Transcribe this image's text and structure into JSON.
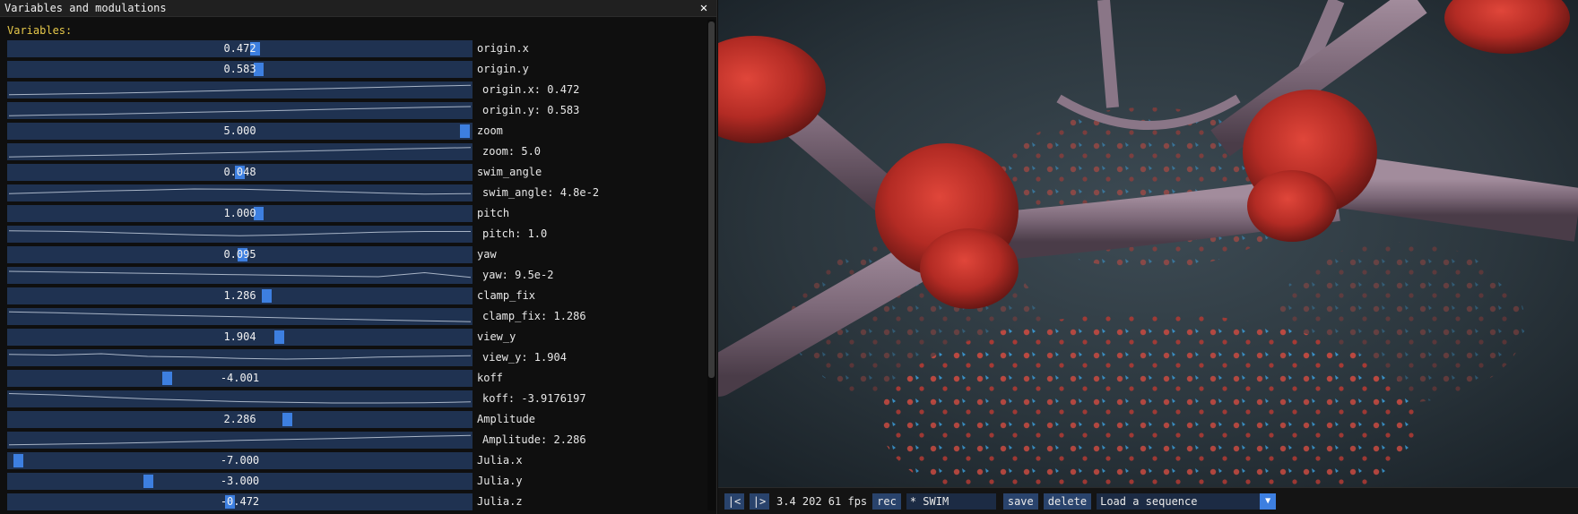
{
  "window": {
    "title": "Variables and modulations",
    "close_icon": "close-icon"
  },
  "variables_heading": "Variables:",
  "rows": [
    {
      "kind": "slider",
      "value": "0.472",
      "label": "origin.x",
      "grab_pct": 0.534
    },
    {
      "kind": "slider",
      "value": "0.583",
      "label": "origin.y",
      "grab_pct": 0.541
    },
    {
      "kind": "plot",
      "label": "origin.x: 0.472",
      "trace": [
        0.85,
        0.8,
        0.75,
        0.68,
        0.6,
        0.52,
        0.45,
        0.38,
        0.3,
        0.22,
        0.15
      ]
    },
    {
      "kind": "plot",
      "label": "origin.y: 0.583",
      "trace": [
        0.88,
        0.82,
        0.77,
        0.7,
        0.63,
        0.56,
        0.48,
        0.4,
        0.33,
        0.26,
        0.2
      ]
    },
    {
      "kind": "slider",
      "value": "5.000",
      "label": "zoom",
      "grab_pct": 0.995
    },
    {
      "kind": "plot",
      "label": "zoom: 5.0",
      "trace": [
        0.88,
        0.82,
        0.76,
        0.7,
        0.62,
        0.55,
        0.47,
        0.4,
        0.32,
        0.25,
        0.18
      ]
    },
    {
      "kind": "slider",
      "value": "0.048",
      "label": "swim_angle",
      "grab_pct": 0.5
    },
    {
      "kind": "plot",
      "label": "swim_angle: 4.8e-2",
      "trace": [
        0.55,
        0.45,
        0.35,
        0.28,
        0.2,
        0.22,
        0.3,
        0.4,
        0.5,
        0.58,
        0.55
      ]
    },
    {
      "kind": "slider",
      "value": "1.000",
      "label": "pitch",
      "grab_pct": 0.541
    },
    {
      "kind": "plot",
      "label": "pitch: 1.0",
      "trace": [
        0.25,
        0.28,
        0.35,
        0.45,
        0.55,
        0.62,
        0.55,
        0.45,
        0.35,
        0.3,
        0.3
      ]
    },
    {
      "kind": "slider",
      "value": "0.095",
      "label": "yaw",
      "grab_pct": 0.505
    },
    {
      "kind": "plot",
      "label": "yaw: 9.5e-2",
      "trace": [
        0.2,
        0.25,
        0.3,
        0.35,
        0.4,
        0.45,
        0.5,
        0.55,
        0.6,
        0.3,
        0.65
      ]
    },
    {
      "kind": "slider",
      "value": "1.286",
      "label": "clamp_fix",
      "grab_pct": 0.56
    },
    {
      "kind": "plot",
      "label": "clamp_fix: 1.286",
      "trace": [
        0.15,
        0.22,
        0.3,
        0.38,
        0.45,
        0.52,
        0.6,
        0.68,
        0.75,
        0.82,
        0.88
      ]
    },
    {
      "kind": "slider",
      "value": "1.904",
      "label": "view_y",
      "grab_pct": 0.587
    },
    {
      "kind": "plot",
      "label": "view_y: 1.904",
      "trace": [
        0.25,
        0.3,
        0.2,
        0.4,
        0.45,
        0.55,
        0.6,
        0.55,
        0.45,
        0.4,
        0.35
      ]
    },
    {
      "kind": "slider",
      "value": "-4.001",
      "label": "koff",
      "grab_pct": 0.34
    },
    {
      "kind": "plot",
      "label": "koff: -3.9176197",
      "trace": [
        0.1,
        0.2,
        0.35,
        0.5,
        0.6,
        0.7,
        0.75,
        0.8,
        0.8,
        0.78,
        0.72
      ]
    },
    {
      "kind": "slider",
      "value": "2.286",
      "label": "Amplitude",
      "grab_pct": 0.605
    },
    {
      "kind": "plot",
      "label": "Amplitude: 2.286",
      "trace": [
        0.85,
        0.8,
        0.75,
        0.68,
        0.6,
        0.52,
        0.45,
        0.38,
        0.3,
        0.22,
        0.15
      ]
    },
    {
      "kind": "slider",
      "value": "-7.000",
      "label": "Julia.x",
      "grab_pct": 0.014
    },
    {
      "kind": "slider",
      "value": "-3.000",
      "label": "Julia.y",
      "grab_pct": 0.3
    },
    {
      "kind": "slider",
      "value": "-0.472",
      "label": "Julia.z",
      "grab_pct": 0.478
    }
  ],
  "toolbar": {
    "prev_label": "|<",
    "play_label": "|>",
    "stats": "3.4 202 61 fps",
    "rec_label": "rec",
    "name_value": "* SWIM",
    "save_label": "save",
    "delete_label": "delete",
    "sequence_value": "Load a sequence",
    "dropdown_icon": "triangle-down-icon"
  },
  "colors": {
    "frame_bg": "#1f3251",
    "grab": "#3d7fe0",
    "heading": "#e6c84a",
    "button": "#29436c"
  }
}
